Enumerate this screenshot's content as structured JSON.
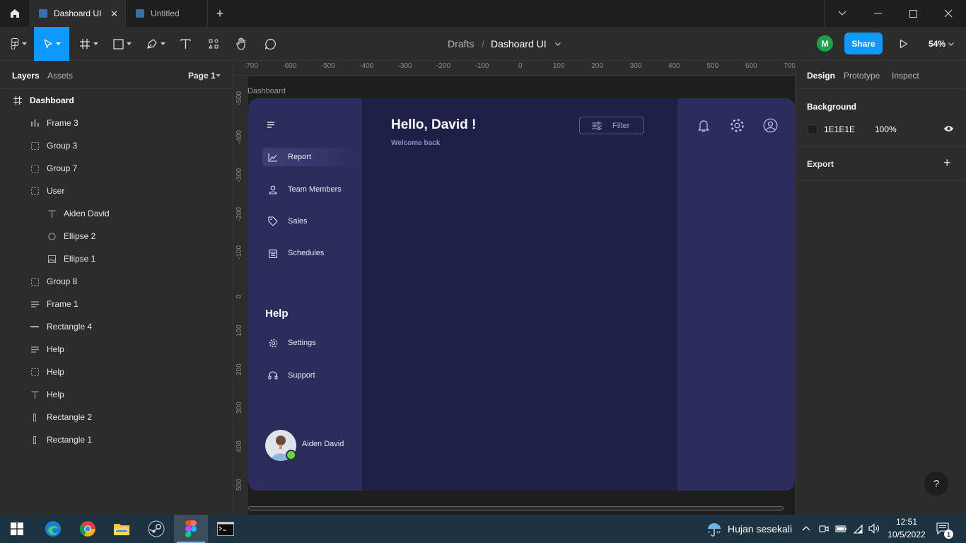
{
  "titlebar": {
    "tabs": [
      {
        "label": "Dashoard UI",
        "active": true
      },
      {
        "label": "Untitled",
        "active": false
      }
    ]
  },
  "toolbar": {
    "breadcrumb_folder": "Drafts",
    "breadcrumb_separator": "/",
    "file_name": "Dashoard UI",
    "user_initial": "M",
    "share_label": "Share",
    "zoom": "54%"
  },
  "left_panel": {
    "tabs": [
      "Layers",
      "Assets"
    ],
    "page_selector": "Page 1",
    "layers": [
      {
        "name": "Dashboard",
        "icon": "frame-hash-icon",
        "level": 0
      },
      {
        "name": "Frame 3",
        "icon": "bar-chart-icon",
        "level": 1
      },
      {
        "name": "Group 3",
        "icon": "group-dashed-icon",
        "level": 1
      },
      {
        "name": "Group 7",
        "icon": "group-dashed-icon",
        "level": 1
      },
      {
        "name": "User",
        "icon": "group-dashed-icon",
        "level": 1
      },
      {
        "name": "Aiden David",
        "icon": "text-icon",
        "level": 2
      },
      {
        "name": "Ellipse 2",
        "icon": "ellipse-icon",
        "level": 2
      },
      {
        "name": "Ellipse 1",
        "icon": "image-icon",
        "level": 2
      },
      {
        "name": "Group 8",
        "icon": "group-dashed-icon",
        "level": 1
      },
      {
        "name": "Frame 1",
        "icon": "auto-layout-icon",
        "level": 1
      },
      {
        "name": "Rectangle 4",
        "icon": "line-icon",
        "level": 1
      },
      {
        "name": "Help",
        "icon": "auto-layout-icon",
        "level": 1
      },
      {
        "name": "Help",
        "icon": "group-dashed-icon",
        "level": 1
      },
      {
        "name": "Help",
        "icon": "text-icon",
        "level": 1
      },
      {
        "name": "Rectangle 2",
        "icon": "vertical-rect-icon",
        "level": 1
      },
      {
        "name": "Rectangle 1",
        "icon": "vertical-rect-icon",
        "level": 1
      }
    ]
  },
  "canvas": {
    "frame_label": "Dashboard",
    "ruler_top": [
      "-700",
      "-600",
      "-500",
      "-400",
      "-300",
      "-200",
      "-100",
      "0",
      "100",
      "200",
      "300",
      "400",
      "500",
      "600",
      "700"
    ],
    "ruler_left": [
      "-500",
      "-400",
      "-300",
      "-200",
      "-100",
      "0",
      "100",
      "200",
      "300",
      "400",
      "500"
    ],
    "dashboard": {
      "greeting": "Hello, David !",
      "subtitle": "Welcome back",
      "filter_label": "Filter",
      "nav": [
        "Report",
        "Team Members",
        "Sales",
        "Schedules"
      ],
      "help_heading": "Help",
      "help_items": [
        "Settings",
        "Support"
      ],
      "user_name": "Aiden David"
    }
  },
  "right_panel": {
    "tabs": [
      "Design",
      "Prototype",
      "Inspect"
    ],
    "background_label": "Background",
    "background_hex": "1E1E1E",
    "background_opacity": "100%",
    "export_label": "Export",
    "help_button": "?"
  },
  "taskbar": {
    "weather": "Hujan sesekali",
    "time": "12:51",
    "date": "10/5/2022",
    "notification_count": "1"
  },
  "colors": {
    "accent": "#0d99ff",
    "frame_bg": "#1f2045",
    "sidebar_bg": "#2b2d5c",
    "online": "#6fd43c"
  }
}
